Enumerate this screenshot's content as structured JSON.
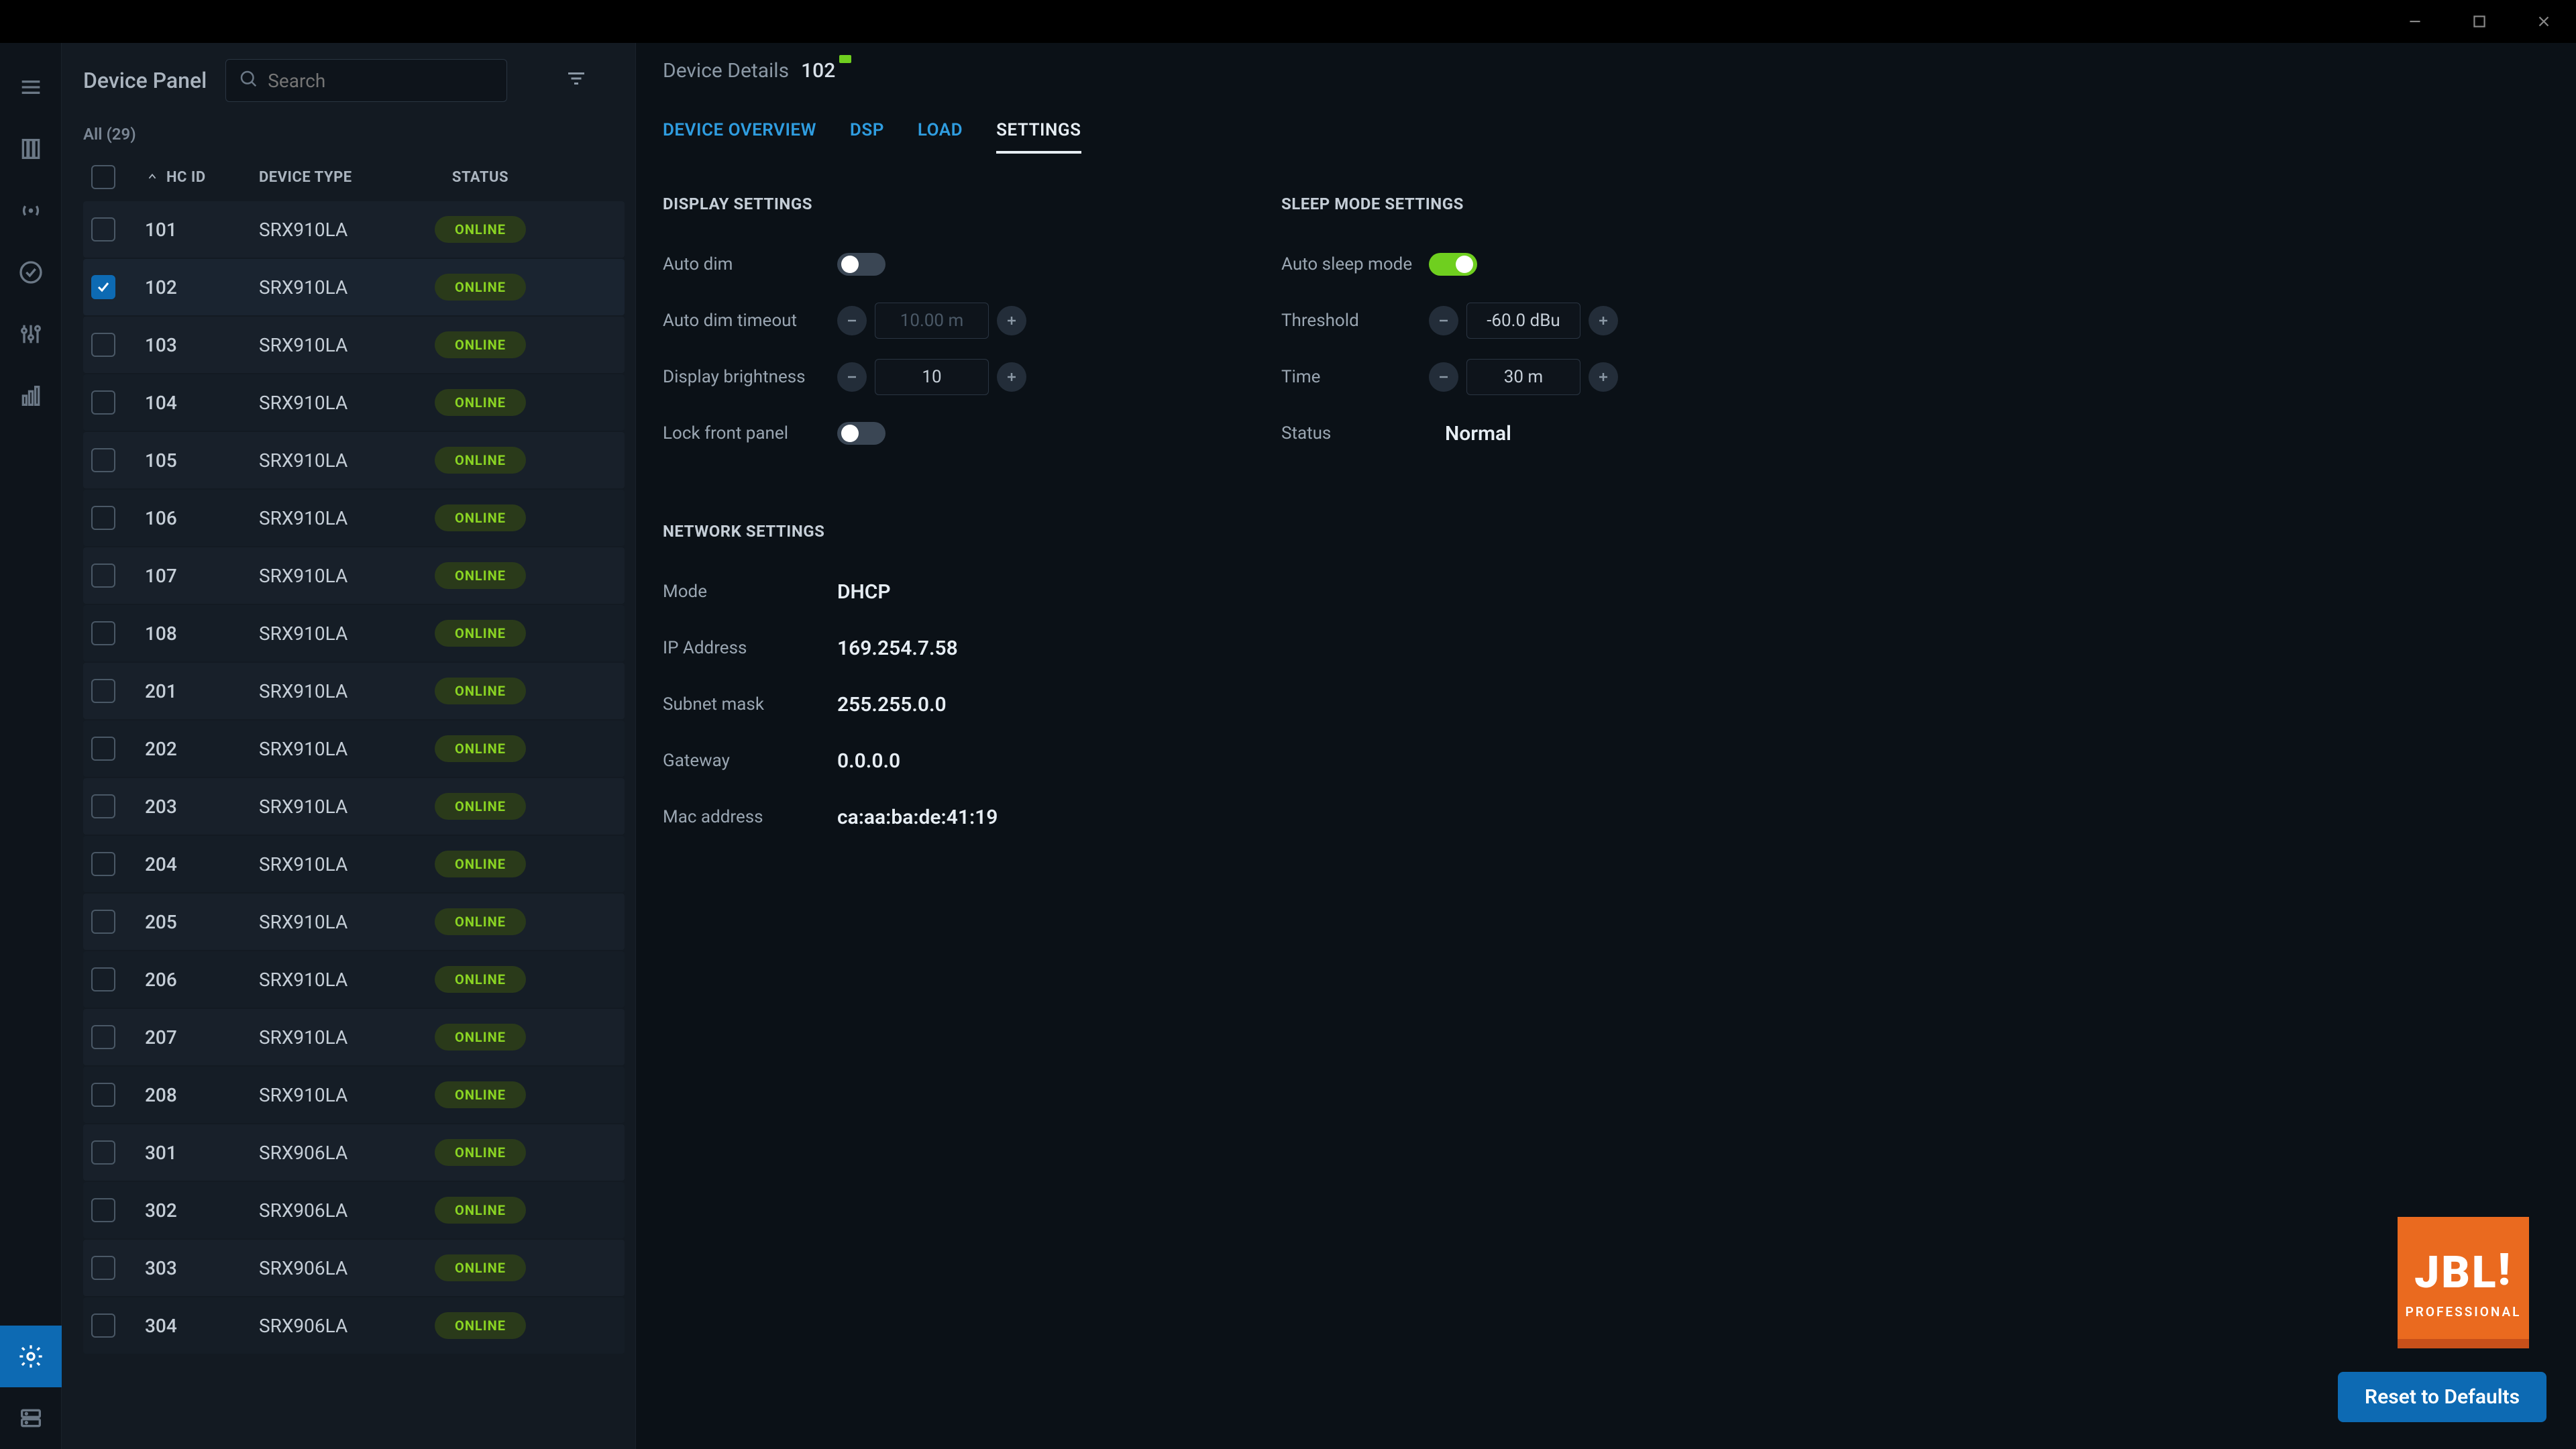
{
  "titlebar": {
    "minimize": "minimize",
    "maximize": "maximize",
    "close": "close"
  },
  "rail": {
    "items": [
      "menu",
      "columns",
      "signal",
      "check-circle",
      "sliders",
      "bar-chart"
    ],
    "active": "gear",
    "bottom": "server"
  },
  "panel": {
    "title": "Device Panel",
    "search_placeholder": "Search",
    "filter_label": "All (29)",
    "columns": {
      "hcid": "HC ID",
      "type": "DEVICE TYPE",
      "status": "STATUS"
    },
    "status_text": "ONLINE",
    "selected_id": "102",
    "rows": [
      {
        "id": "101",
        "type": "SRX910LA",
        "status": "ONLINE"
      },
      {
        "id": "102",
        "type": "SRX910LA",
        "status": "ONLINE"
      },
      {
        "id": "103",
        "type": "SRX910LA",
        "status": "ONLINE"
      },
      {
        "id": "104",
        "type": "SRX910LA",
        "status": "ONLINE"
      },
      {
        "id": "105",
        "type": "SRX910LA",
        "status": "ONLINE"
      },
      {
        "id": "106",
        "type": "SRX910LA",
        "status": "ONLINE"
      },
      {
        "id": "107",
        "type": "SRX910LA",
        "status": "ONLINE"
      },
      {
        "id": "108",
        "type": "SRX910LA",
        "status": "ONLINE"
      },
      {
        "id": "201",
        "type": "SRX910LA",
        "status": "ONLINE"
      },
      {
        "id": "202",
        "type": "SRX910LA",
        "status": "ONLINE"
      },
      {
        "id": "203",
        "type": "SRX910LA",
        "status": "ONLINE"
      },
      {
        "id": "204",
        "type": "SRX910LA",
        "status": "ONLINE"
      },
      {
        "id": "205",
        "type": "SRX910LA",
        "status": "ONLINE"
      },
      {
        "id": "206",
        "type": "SRX910LA",
        "status": "ONLINE"
      },
      {
        "id": "207",
        "type": "SRX910LA",
        "status": "ONLINE"
      },
      {
        "id": "208",
        "type": "SRX910LA",
        "status": "ONLINE"
      },
      {
        "id": "301",
        "type": "SRX906LA",
        "status": "ONLINE"
      },
      {
        "id": "302",
        "type": "SRX906LA",
        "status": "ONLINE"
      },
      {
        "id": "303",
        "type": "SRX906LA",
        "status": "ONLINE"
      },
      {
        "id": "304",
        "type": "SRX906LA",
        "status": "ONLINE"
      }
    ]
  },
  "details": {
    "breadcrumb": "Device Details",
    "device_id": "102",
    "tabs": [
      {
        "key": "overview",
        "label": "DEVICE OVERVIEW"
      },
      {
        "key": "dsp",
        "label": "DSP"
      },
      {
        "key": "load",
        "label": "LOAD"
      },
      {
        "key": "settings",
        "label": "SETTINGS"
      }
    ],
    "active_tab": "settings"
  },
  "display_settings": {
    "title": "DISPLAY SETTINGS",
    "auto_dim_label": "Auto dim",
    "auto_dim_on": false,
    "auto_dim_timeout_label": "Auto dim timeout",
    "auto_dim_timeout_value": "10.00 m",
    "brightness_label": "Display brightness",
    "brightness_value": "10",
    "lock_label": "Lock front panel",
    "lock_on": false
  },
  "sleep_settings": {
    "title": "SLEEP MODE SETTINGS",
    "auto_sleep_label": "Auto sleep mode",
    "auto_sleep_on": true,
    "threshold_label": "Threshold",
    "threshold_value": "-60.0 dBu",
    "time_label": "Time",
    "time_value": "30 m",
    "status_label": "Status",
    "status_value": "Normal"
  },
  "network_settings": {
    "title": "NETWORK SETTINGS",
    "mode_label": "Mode",
    "mode_value": "DHCP",
    "ip_label": "IP Address",
    "ip_value": "169.254.7.58",
    "subnet_label": "Subnet mask",
    "subnet_value": "255.255.0.0",
    "gateway_label": "Gateway",
    "gateway_value": "0.0.0.0",
    "mac_label": "Mac address",
    "mac_value": "ca:aa:ba:de:41:19"
  },
  "brand": {
    "name": "JBL",
    "sub": "PROFESSIONAL"
  },
  "reset_label": "Reset to Defaults"
}
